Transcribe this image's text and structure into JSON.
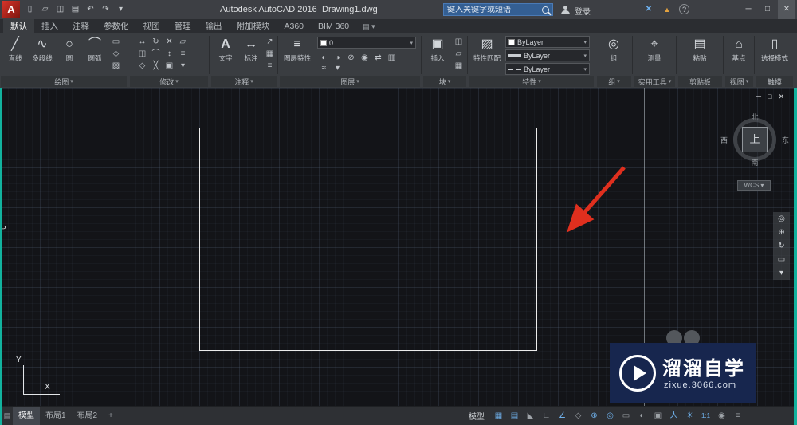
{
  "colors": {
    "arrow": "#df2f1e",
    "accent_blue": "#6fb0ea",
    "watermark_bg": "#17264e",
    "edge_strip": "#12b29e"
  },
  "titlebar": {
    "logo_letter": "A",
    "qat_glyphs": [
      "▯",
      "▱",
      "◫",
      "▤",
      "↶",
      "↷",
      "▾"
    ],
    "app_title": "Autodesk AutoCAD 2016",
    "doc_title": "Drawing1.dwg",
    "search_placeholder": "键入关键字或短语",
    "signin_label": "登录",
    "exchange_glyph": "✕",
    "apps_glyph": "▲",
    "help_glyph": "?",
    "win": {
      "min": "─",
      "max": "□",
      "close": "✕"
    }
  },
  "tabrow": {
    "tabs": [
      "默认",
      "插入",
      "注释",
      "参数化",
      "视图",
      "管理",
      "输出",
      "附加模块",
      "A360",
      "BIM 360"
    ],
    "active_tab": "默认",
    "toggle_glyph": "▤ ▾"
  },
  "ribbon": {
    "caret": "▾",
    "draw": {
      "label": "绘图",
      "buttons": [
        {
          "g": "╱",
          "t": "直线"
        },
        {
          "g": "∿",
          "t": "多段线"
        },
        {
          "g": "○",
          "t": "圆"
        },
        {
          "g": "⌒",
          "t": "圆弧"
        }
      ],
      "small": [
        "▭",
        "◇",
        "▨"
      ]
    },
    "modify": {
      "label": "修改",
      "small": [
        "↔",
        "↻",
        "✕",
        "▱",
        "◫",
        "⌒",
        "↕",
        "≡",
        "◇",
        "╳",
        "▣",
        "▾"
      ]
    },
    "annotation": {
      "label": "注释",
      "buttons": [
        {
          "g": "A",
          "t": "文字"
        },
        {
          "g": "↔",
          "t": "标注"
        }
      ],
      "small": [
        "↗",
        "▦",
        "≡"
      ]
    },
    "layers": {
      "label": "图层",
      "main": {
        "g": "≡",
        "t": "图层特性"
      },
      "dropdown_value": "0",
      "small": [
        "◐",
        "◑",
        "⊘",
        "◉",
        "⇄",
        "▥",
        "≈",
        "▾"
      ]
    },
    "block": {
      "label": "块",
      "main": {
        "g": "▣",
        "t": "插入"
      },
      "small": [
        "◫",
        "▱",
        "▦"
      ]
    },
    "properties": {
      "label": "特性",
      "main": {
        "g": "▨",
        "t": "特性匹配"
      },
      "values": [
        "ByLayer",
        "ByLayer",
        "ByLayer"
      ]
    },
    "groups": {
      "label": "组",
      "main": {
        "g": "◎",
        "t": "组"
      }
    },
    "utilities": {
      "label": "实用工具",
      "main": {
        "g": "⌖",
        "t": "测量"
      }
    },
    "clipboard": {
      "label": "剪贴板",
      "main": {
        "g": "▤",
        "t": "粘贴"
      }
    },
    "view": {
      "label": "视图",
      "main": {
        "g": "⌂",
        "t": "基点"
      }
    },
    "touch": {
      "label": "触摸",
      "main": {
        "g": "▯",
        "t": "选择模式"
      }
    }
  },
  "canvas": {
    "win_controls": [
      "─",
      "□",
      "✕"
    ],
    "edge_letter": "P"
  },
  "viewcube": {
    "n": "北",
    "s": "南",
    "w": "西",
    "e": "东",
    "top": "上",
    "wcs": "WCS ▾"
  },
  "navbar": {
    "glyphs": [
      "◎",
      "⊕",
      "↻",
      "▭",
      "▾"
    ]
  },
  "ucs": {
    "x": "X",
    "y": "Y"
  },
  "watermark": {
    "title": "溜溜自学",
    "url": "zixue.3066.com"
  },
  "layout_tabs": {
    "icon": "▤",
    "model": "模型",
    "layout1": "布局1",
    "layout2": "布局2",
    "add": "+"
  },
  "statusbar": {
    "model_label": "模型",
    "icons": [
      {
        "g": "▦",
        "c": "b"
      },
      {
        "g": "▤",
        "c": "b"
      },
      {
        "g": "◣",
        "c": "g"
      },
      {
        "g": "∟",
        "c": "g"
      },
      {
        "g": "∠",
        "c": "b"
      },
      {
        "g": "◇",
        "c": "g"
      },
      {
        "g": "⊕",
        "c": "b"
      },
      {
        "g": "◎",
        "c": "b"
      },
      {
        "g": "▭",
        "c": "g"
      },
      {
        "g": "◐",
        "c": "g"
      },
      {
        "g": "▣",
        "c": "g"
      },
      {
        "g": "人",
        "c": "b"
      },
      {
        "g": "☀",
        "c": "b"
      },
      {
        "g": "1:1",
        "c": "b"
      },
      {
        "g": "◉",
        "c": "g"
      },
      {
        "g": "≡",
        "c": "g"
      }
    ]
  }
}
